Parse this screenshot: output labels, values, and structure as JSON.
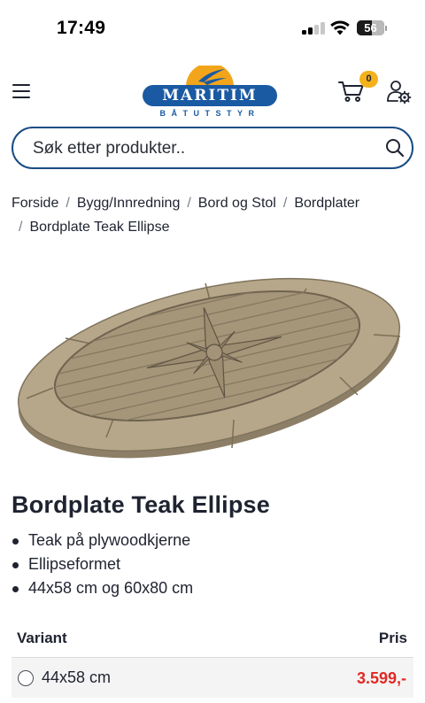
{
  "status_bar": {
    "time": "17:49",
    "battery": "56",
    "battery_level": 0.56,
    "signal_bars_filled": 2,
    "signal_bars_total": 4
  },
  "header": {
    "logo_text": "MARITIM",
    "logo_subtext": "BÅTUTSTYR",
    "cart_count": "0",
    "brand_color": "#1a5aa3",
    "badge_color": "#f2b21b"
  },
  "search": {
    "placeholder": "Søk etter produkter.."
  },
  "breadcrumb": {
    "items": [
      "Forside",
      "Bygg/Innredning",
      "Bord og Stol",
      "Bordplater"
    ],
    "current": "Bordplate Teak Ellipse"
  },
  "product": {
    "title": "Bordplate Teak Ellipse",
    "features": [
      "Teak på plywoodkjerne",
      "Ellipseformet",
      "44x58 cm og 60x80 cm"
    ]
  },
  "variants": {
    "header_variant": "Variant",
    "header_price": "Pris",
    "rows": [
      {
        "name": "44x58 cm",
        "price": "3.599,-"
      }
    ],
    "price_color": "#e12a25"
  }
}
